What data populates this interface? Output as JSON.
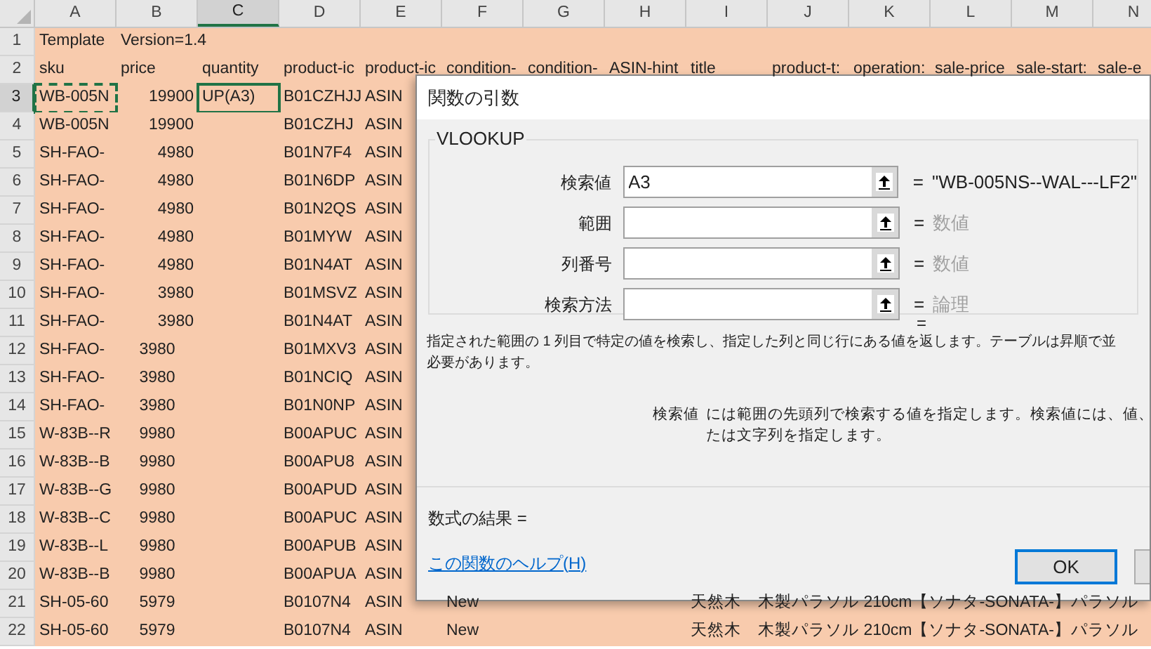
{
  "columns": [
    {
      "label": "A",
      "selected": false
    },
    {
      "label": "B",
      "selected": false
    },
    {
      "label": "C",
      "selected": true
    },
    {
      "label": "D",
      "selected": false
    },
    {
      "label": "E",
      "selected": false
    },
    {
      "label": "F",
      "selected": false
    },
    {
      "label": "G",
      "selected": false
    },
    {
      "label": "H",
      "selected": false
    },
    {
      "label": "I",
      "selected": false
    },
    {
      "label": "J",
      "selected": false
    },
    {
      "label": "K",
      "selected": false
    },
    {
      "label": "L",
      "selected": false
    },
    {
      "label": "M",
      "selected": false
    },
    {
      "label": "N",
      "selected": false
    }
  ],
  "rows": [
    {
      "number": "1",
      "selected": false,
      "copied": false,
      "cells": [
        "Template",
        "Version=1.4"
      ]
    },
    {
      "number": "2",
      "selected": false,
      "copied": false,
      "cells": [
        "sku",
        "price",
        "quantity",
        "product-ic",
        "product-ic",
        "condition-",
        "condition-",
        "ASIN-hint",
        "title",
        "product-t:",
        "operation:",
        "sale-price",
        "sale-start:",
        "sale-e"
      ]
    },
    {
      "number": "3",
      "selected": true,
      "copied": true,
      "kind": "numeric",
      "cells": [
        "WB-005N",
        "19900",
        "UP(A3)",
        "B01CZHJJ",
        "ASIN"
      ]
    },
    {
      "number": "4",
      "selected": false,
      "copied": false,
      "kind": "numeric",
      "cells": [
        "WB-005N",
        "19900",
        null,
        "B01CZHJ",
        "ASIN"
      ]
    },
    {
      "number": "5",
      "selected": false,
      "copied": false,
      "kind": "numeric",
      "cells": [
        "SH-FAO-",
        "4980",
        null,
        "B01N7F4",
        "ASIN"
      ]
    },
    {
      "number": "6",
      "selected": false,
      "copied": false,
      "kind": "numeric",
      "cells": [
        "SH-FAO-",
        "4980",
        null,
        "B01N6DP",
        "ASIN"
      ]
    },
    {
      "number": "7",
      "selected": false,
      "copied": false,
      "kind": "numeric",
      "cells": [
        "SH-FAO-",
        "4980",
        null,
        "B01N2QS",
        "ASIN"
      ]
    },
    {
      "number": "8",
      "selected": false,
      "copied": false,
      "kind": "numeric",
      "cells": [
        "SH-FAO-",
        "4980",
        null,
        "B01MYW",
        "ASIN"
      ]
    },
    {
      "number": "9",
      "selected": false,
      "copied": false,
      "kind": "numeric",
      "cells": [
        "SH-FAO-",
        "4980",
        null,
        "B01N4AT",
        "ASIN"
      ]
    },
    {
      "number": "10",
      "selected": false,
      "copied": false,
      "kind": "numeric",
      "cells": [
        "SH-FAO-",
        "3980",
        null,
        "B01MSVZ",
        "ASIN"
      ]
    },
    {
      "number": "11",
      "selected": false,
      "copied": false,
      "kind": "numeric",
      "cells": [
        "SH-FAO-",
        "3980",
        null,
        "B01N4AT",
        "ASIN"
      ]
    },
    {
      "number": "12",
      "selected": false,
      "copied": false,
      "kind": "text",
      "cells": [
        "SH-FAO-",
        "3980",
        null,
        "B01MXV3",
        "ASIN"
      ]
    },
    {
      "number": "13",
      "selected": false,
      "copied": false,
      "kind": "text",
      "cells": [
        "SH-FAO-",
        "3980",
        null,
        "B01NCIQ",
        "ASIN"
      ]
    },
    {
      "number": "14",
      "selected": false,
      "copied": false,
      "kind": "text",
      "cells": [
        "SH-FAO-",
        "3980",
        null,
        "B01N0NP",
        "ASIN"
      ]
    },
    {
      "number": "15",
      "selected": false,
      "copied": false,
      "kind": "text",
      "cells": [
        "W-83B--R",
        "9980",
        null,
        "B00APUC",
        "ASIN"
      ]
    },
    {
      "number": "16",
      "selected": false,
      "copied": false,
      "kind": "text",
      "cells": [
        "W-83B--B",
        "9980",
        null,
        "B00APU8",
        "ASIN"
      ]
    },
    {
      "number": "17",
      "selected": false,
      "copied": false,
      "kind": "text",
      "cells": [
        "W-83B--G",
        "9980",
        null,
        "B00APUD",
        "ASIN"
      ]
    },
    {
      "number": "18",
      "selected": false,
      "copied": false,
      "kind": "text",
      "cells": [
        "W-83B--C",
        "9980",
        null,
        "B00APUC",
        "ASIN"
      ]
    },
    {
      "number": "19",
      "selected": false,
      "copied": false,
      "kind": "text",
      "cells": [
        "W-83B--L",
        "9980",
        null,
        "B00APUB",
        "ASIN"
      ]
    },
    {
      "number": "20",
      "selected": false,
      "copied": false,
      "kind": "text",
      "cells": [
        "W-83B--B",
        "9980",
        null,
        "B00APUA",
        "ASIN"
      ]
    },
    {
      "number": "21",
      "selected": false,
      "copied": false,
      "kind": "text",
      "cells": [
        "SH-05-60",
        "5979",
        null,
        "B0107N4",
        "ASIN",
        "New",
        null,
        null,
        "天然木　木製パラソル 210cm【ソナタ-SONATA-】パラソル"
      ]
    },
    {
      "number": "22",
      "selected": false,
      "copied": false,
      "kind": "text",
      "cells": [
        "SH-05-60",
        "5979",
        null,
        "B0107N4",
        "ASIN",
        "New",
        null,
        null,
        "天然木　木製パラソル 210cm【ソナタ-SONATA-】パラソル"
      ]
    }
  ],
  "dialog": {
    "title": "関数の引数",
    "function_name": "VLOOKUP",
    "arguments": [
      {
        "label": "検索値",
        "value": "A3",
        "equals": "=",
        "result": "\"WB-005NS--WAL---LF2\"",
        "kind": "value"
      },
      {
        "label": "範囲",
        "equals": "=",
        "result": "数値",
        "kind": "hint"
      },
      {
        "label": "列番号",
        "equals": "=",
        "result": "数値",
        "kind": "hint"
      },
      {
        "label": "検索方法",
        "equals": "=",
        "result": "論理",
        "kind": "hint"
      }
    ],
    "overall_equals": "=",
    "description_lines": [
      "指定された範囲の 1 列目で特定の値を検索し、指定した列と同じ行にある値を返します。テーブルは昇順で並",
      "必要があります。"
    ],
    "argument_help": {
      "label": "検索値",
      "lines": [
        "には範囲の先頭列で検索する値を指定します。検索値には、値、",
        "たは文字列を指定します。"
      ]
    },
    "formula_result": "数式の結果 =",
    "help_link": "この関数のヘルプ(H)",
    "ok_button": "OK"
  }
}
